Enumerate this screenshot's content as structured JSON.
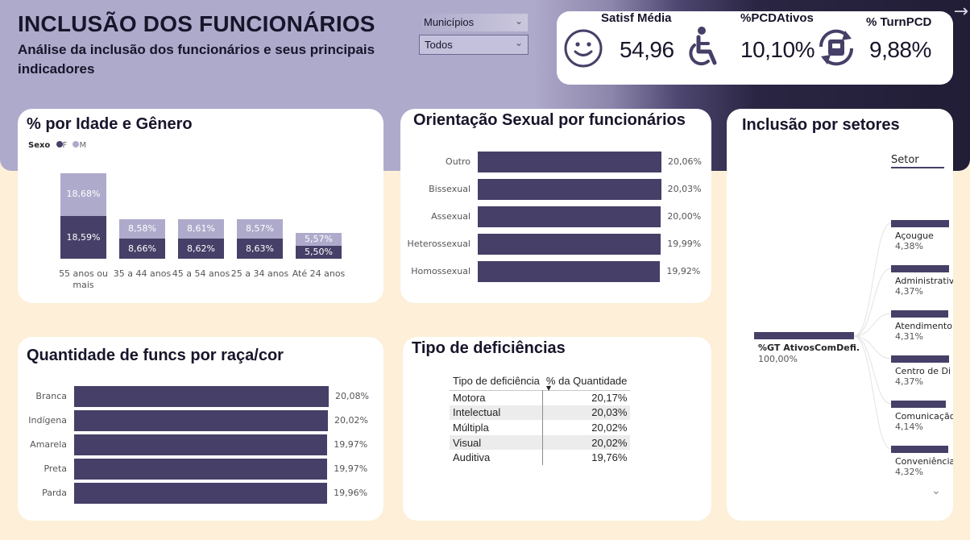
{
  "header": {
    "title": "INCLUSÃO DOS FUNCIONÁRIOS",
    "subtitle": "Análise da inclusão dos funcionários e seus principais indicadores"
  },
  "slicer": {
    "label": "Municípios",
    "value": "Todos"
  },
  "kpis": {
    "satisfacao": {
      "label": "Satisf Média",
      "value": "54,96",
      "icon": "smiley-icon"
    },
    "pcd_ativos": {
      "label": "%PCDAtivos",
      "value": "10,10%",
      "icon": "wheelchair-icon"
    },
    "turn_pcd": {
      "label": "% TurnPCD",
      "value": "9,88%",
      "icon": "turnover-icon"
    }
  },
  "colors": {
    "dark": "#463f67",
    "light": "#aeaacb",
    "accent_bg": "#fdefd8"
  },
  "chart_data": [
    {
      "id": "idade_genero",
      "type": "bar",
      "stacked": true,
      "title": "% por Idade e Gênero",
      "legend_title": "Sexo",
      "categories": [
        "55 anos ou mais",
        "35 a 44 anos",
        "45 a 54 anos",
        "25 a 34 anos",
        "Até 24 anos"
      ],
      "series": [
        {
          "name": "F",
          "values": [
            18.59,
            8.66,
            8.62,
            8.63,
            5.5
          ],
          "labels": [
            "18,59%",
            "8,66%",
            "8,62%",
            "8,63%",
            "5,50%"
          ]
        },
        {
          "name": "M",
          "values": [
            18.68,
            8.58,
            8.61,
            8.57,
            5.57
          ],
          "labels": [
            "18,68%",
            "8,58%",
            "8,61%",
            "8,57%",
            "5,57%"
          ]
        }
      ],
      "legend": "top-left",
      "grid": false
    },
    {
      "id": "orientacao",
      "type": "bar",
      "orientation": "horizontal",
      "title": "Orientação Sexual por funcionários",
      "categories": [
        "Outro",
        "Bissexual",
        "Assexual",
        "Heterossexual",
        "Homossexual"
      ],
      "values": [
        20.06,
        20.03,
        20.0,
        19.99,
        19.92
      ],
      "labels": [
        "20,06%",
        "20,03%",
        "20,00%",
        "19,99%",
        "19,92%"
      ],
      "xlim": [
        0,
        20.06
      ]
    },
    {
      "id": "raca",
      "type": "bar",
      "orientation": "horizontal",
      "title": "Quantidade de funcs por raça/cor",
      "categories": [
        "Branca",
        "Indígena",
        "Amarela",
        "Preta",
        "Parda"
      ],
      "values": [
        20.08,
        20.02,
        19.97,
        19.97,
        19.96
      ],
      "labels": [
        "20,08%",
        "20,02%",
        "19,97%",
        "19,97%",
        "19,96%"
      ],
      "xlim": [
        0,
        20.08
      ]
    },
    {
      "id": "deficiencias",
      "type": "table",
      "title": "Tipo de deficiências",
      "columns": [
        "Tipo de deficiência",
        "% da Quantidade"
      ],
      "rows": [
        [
          "Motora",
          "20,17%"
        ],
        [
          "Intelectual",
          "20,03%"
        ],
        [
          "Múltipla",
          "20,02%"
        ],
        [
          "Visual",
          "20,02%"
        ],
        [
          "Auditiva",
          "19,76%"
        ]
      ]
    },
    {
      "id": "setores",
      "type": "bar",
      "title": "Inclusão por setores",
      "root": {
        "label": "%GT AtivosComDefi...",
        "value": 100.0,
        "pct": "100,00%"
      },
      "level_label": "Setor",
      "categories": [
        "Açougue",
        "Administrativo",
        "Atendimento",
        "Centro de Di",
        "Comunicação",
        "Conveniência"
      ],
      "values": [
        4.38,
        4.37,
        4.31,
        4.37,
        4.14,
        4.32
      ],
      "labels": [
        "4,38%",
        "4,37%",
        "4,31%",
        "4,37%",
        "4,14%",
        "4,32%"
      ]
    }
  ]
}
